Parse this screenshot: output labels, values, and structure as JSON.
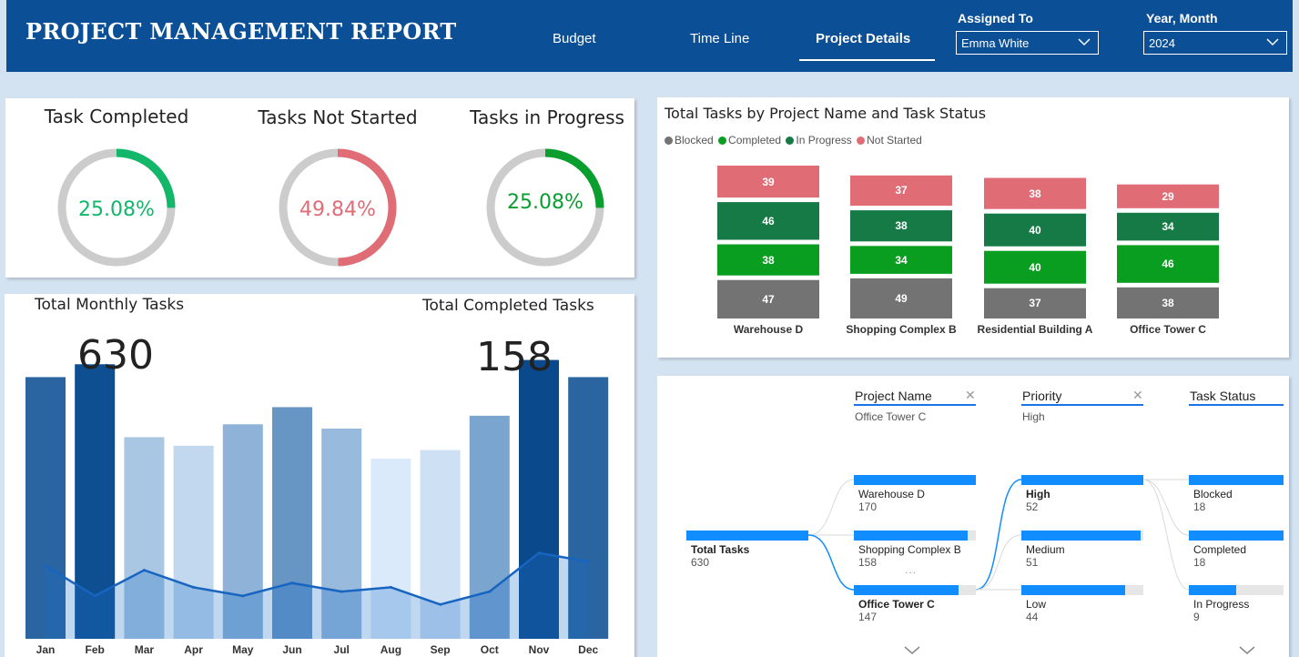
{
  "header": {
    "title": "PROJECT MANAGEMENT REPORT",
    "tabs": [
      {
        "label": "Budget",
        "active": false
      },
      {
        "label": "Time Line",
        "active": false
      },
      {
        "label": "Project Details",
        "active": true
      }
    ],
    "filters": {
      "assigned_label": "Assigned To",
      "assigned_value": "Emma White",
      "year_label": "Year, Month",
      "year_value": "2024"
    },
    "color": "#0b4f96"
  },
  "kpis": [
    {
      "title": "Task Completed",
      "value": "25.08%",
      "fraction": 0.2508,
      "color": "#12b76a"
    },
    {
      "title": "Tasks Not Started",
      "value": "49.84%",
      "fraction": 0.4984,
      "color": "#e06c75"
    },
    {
      "title": "Tasks in Progress",
      "value": "25.08%",
      "fraction": 0.2508,
      "color": "#0a9e2f"
    }
  ],
  "monthly": {
    "title_left": "Total Monthly Tasks",
    "title_right": "Total Completed Tasks",
    "total_tasks": "630",
    "total_completed": "158"
  },
  "stacked": {
    "title": "Total Tasks by Project Name and Task Status",
    "legend": [
      {
        "name": "Blocked",
        "color": "#737373"
      },
      {
        "name": "Completed",
        "color": "#0a9e20"
      },
      {
        "name": "In Progress",
        "color": "#167a47"
      },
      {
        "name": "Not Started",
        "color": "#e06c75"
      }
    ]
  },
  "chart_data": [
    {
      "type": "bar",
      "title": "Total Monthly Tasks",
      "categories": [
        "Jan",
        "Feb",
        "Mar",
        "Apr",
        "May",
        "Jun",
        "Jul",
        "Aug",
        "Sep",
        "Oct",
        "Nov",
        "Dec"
      ],
      "series": [
        {
          "name": "Total Tasks",
          "values": [
            61,
            64,
            47,
            45,
            50,
            54,
            49,
            42,
            44,
            52,
            65,
            61
          ]
        },
        {
          "name": "Completed Tasks",
          "values": [
            17,
            10,
            16,
            12,
            10,
            13,
            11,
            12,
            8,
            11,
            20,
            18
          ]
        }
      ],
      "bar_colors": [
        "#2a65a1",
        "#0e4f91",
        "#a9c6e3",
        "#c2d8ef",
        "#8fb3d8",
        "#6796c4",
        "#98badc",
        "#dbeafb",
        "#cde0f4",
        "#7aa5cf",
        "#0a4a8c",
        "#2a65a1"
      ],
      "line_color": "#1765c0",
      "ylim": [
        0,
        70
      ]
    },
    {
      "type": "bar",
      "stacked": true,
      "title": "Total Tasks by Project Name and Task Status",
      "categories": [
        "Warehouse D",
        "Shopping Complex B",
        "Residential Building A",
        "Office Tower C"
      ],
      "series": [
        {
          "name": "Blocked",
          "values": [
            47,
            49,
            37,
            38
          ]
        },
        {
          "name": "Completed",
          "values": [
            38,
            34,
            40,
            46
          ]
        },
        {
          "name": "In Progress",
          "values": [
            46,
            38,
            40,
            34
          ]
        },
        {
          "name": "Not Started",
          "values": [
            39,
            37,
            38,
            29
          ]
        }
      ]
    }
  ],
  "tree": {
    "headers": [
      {
        "label": "Project Name",
        "sub": "Office Tower C",
        "closable": true
      },
      {
        "label": "Priority",
        "sub": "High",
        "closable": true
      },
      {
        "label": "Task Status",
        "sub": "",
        "closable": false
      }
    ],
    "root": {
      "label": "Total Tasks",
      "value": "630",
      "fraction": 1.0
    },
    "projects": [
      {
        "label": "Warehouse D",
        "value": "170",
        "fraction": 1.0,
        "selected": false
      },
      {
        "label": "Shopping Complex B",
        "value": "158",
        "fraction": 0.93,
        "selected": false
      },
      {
        "label": "Office Tower C",
        "value": "147",
        "fraction": 0.86,
        "selected": true
      }
    ],
    "priorities": [
      {
        "label": "High",
        "value": "52",
        "fraction": 1.0,
        "selected": true
      },
      {
        "label": "Medium",
        "value": "51",
        "fraction": 0.98,
        "selected": false
      },
      {
        "label": "Low",
        "value": "44",
        "fraction": 0.85,
        "selected": false
      }
    ],
    "statuses": [
      {
        "label": "Blocked",
        "value": "18",
        "fraction": 1.0
      },
      {
        "label": "Completed",
        "value": "18",
        "fraction": 1.0
      },
      {
        "label": "In Progress",
        "value": "9",
        "fraction": 0.5
      }
    ],
    "more_glyph": "...",
    "accent": "#118dff"
  }
}
